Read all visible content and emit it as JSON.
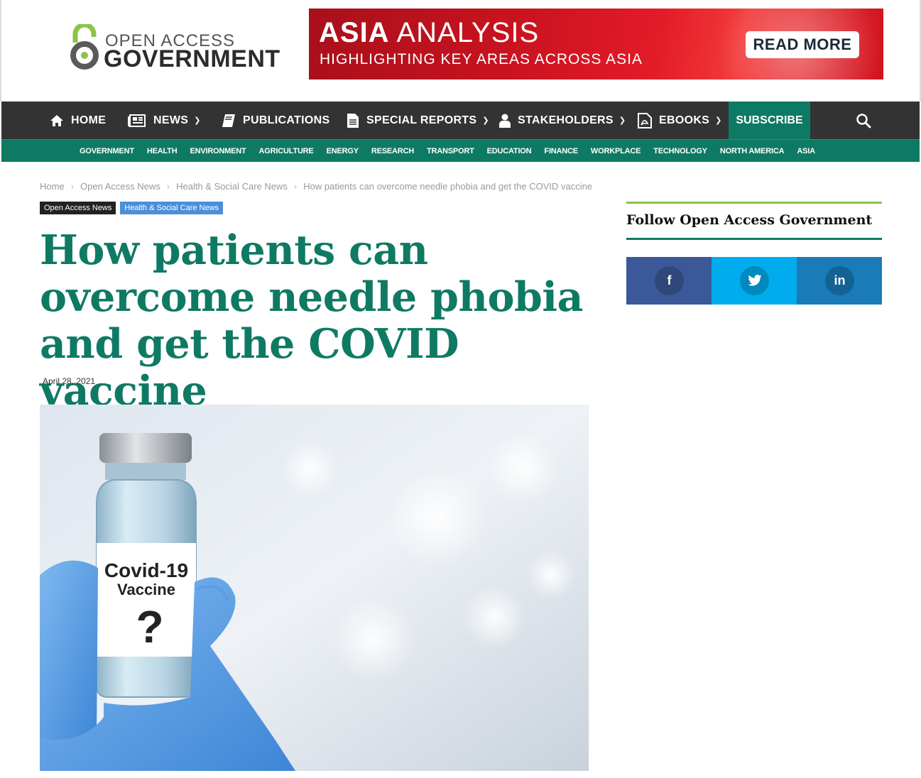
{
  "logo": {
    "line1": "OPEN ACCESS",
    "line2": "GOVERNMENT"
  },
  "banner": {
    "title_bold": "ASIA",
    "title_rest": " ANALYSIS",
    "subtitle": "HIGHLIGHTING KEY AREAS ACROSS ASIA",
    "button": "READ MORE"
  },
  "mainnav": {
    "items": [
      {
        "label": "HOME",
        "icon": "home-icon"
      },
      {
        "label": "NEWS",
        "icon": "newspaper-icon"
      },
      {
        "label": "PUBLICATIONS",
        "icon": "book-icon"
      },
      {
        "label": "SPECIAL REPORTS",
        "icon": "document-icon"
      },
      {
        "label": "STAKEHOLDERS",
        "icon": "user-icon"
      },
      {
        "label": "EBOOKS",
        "icon": "pdf-icon"
      }
    ],
    "subscribe": "SUBSCRIBE",
    "dropdown_arrow": "⌄"
  },
  "categories": [
    "GOVERNMENT",
    "HEALTH",
    "ENVIRONMENT",
    "AGRICULTURE",
    "ENERGY",
    "RESEARCH",
    "TRANSPORT",
    "EDUCATION",
    "FINANCE",
    "WORKPLACE",
    "TECHNOLOGY",
    "NORTH AMERICA",
    "ASIA"
  ],
  "breadcrumb": {
    "items": [
      "Home",
      "Open Access News",
      "Health & Social Care News",
      "How patients can overcome needle phobia and get the COVID vaccine"
    ],
    "separator": "›"
  },
  "tags": [
    "Open Access News",
    "Health & Social Care News"
  ],
  "article": {
    "title": "How patients can overcome needle phobia and get the COVID vaccine",
    "date": "April 28, 2021",
    "image_label_1": "Covid-19",
    "image_label_2": "Vaccine",
    "image_label_3": "?"
  },
  "sidebar": {
    "title": "Follow Open Access Government",
    "social": [
      {
        "label": "f",
        "color": "#3b5998"
      },
      {
        "label": "🐦",
        "color": "#00aced"
      },
      {
        "label": "in",
        "color": "#1a7bb9"
      }
    ]
  },
  "colors": {
    "brand_green": "#0f7a63",
    "nav_dark": "#333333",
    "accent_lime": "#8bc34a"
  }
}
